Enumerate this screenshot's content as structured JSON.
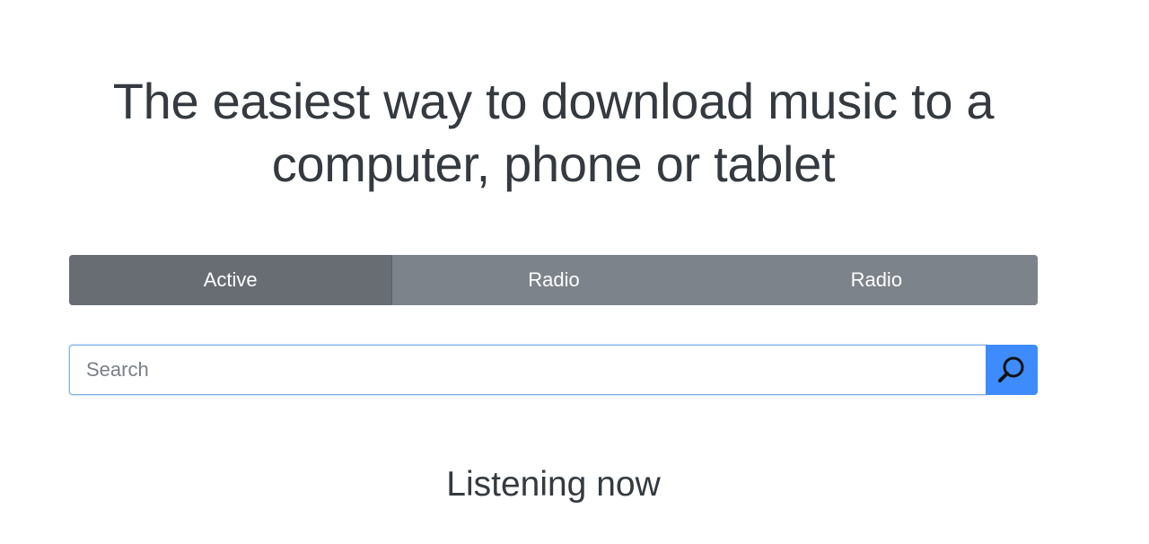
{
  "hero": {
    "title": "The easiest way to download music to a computer, phone or tablet"
  },
  "tabs": [
    {
      "label": "Active",
      "active": true
    },
    {
      "label": "Radio",
      "active": false
    },
    {
      "label": "Radio",
      "active": false
    }
  ],
  "search": {
    "placeholder": "Search",
    "value": "",
    "button_icon": "search-icon"
  },
  "listening": {
    "title": "Listening now"
  },
  "colors": {
    "tab_active": "#686d74",
    "tab_inactive": "#7d838a",
    "search_button": "#3d8bfd",
    "text": "#343a40"
  }
}
